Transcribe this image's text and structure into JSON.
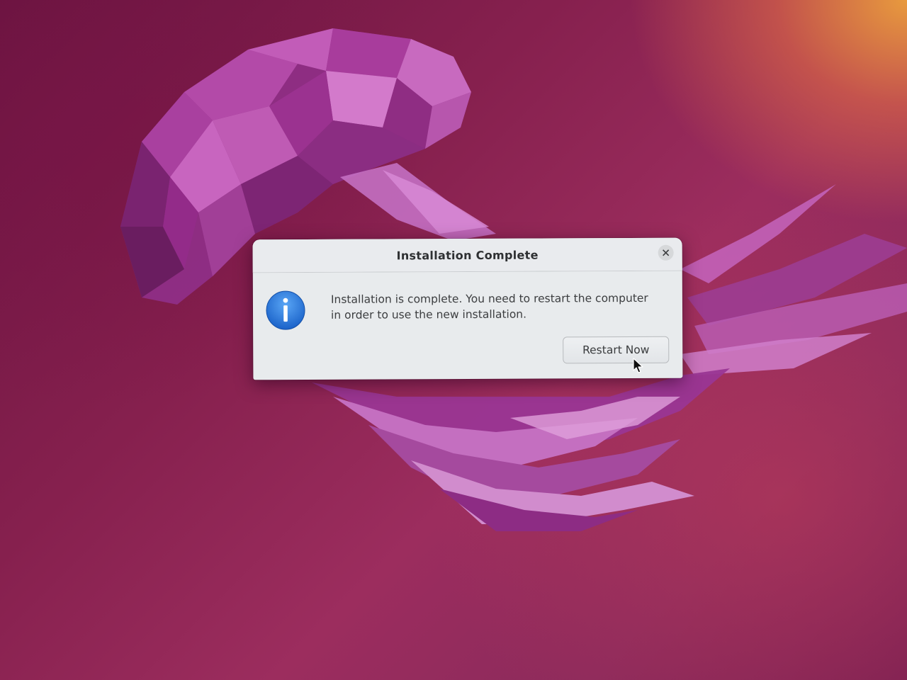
{
  "dialog": {
    "title": "Installation Complete",
    "message_line1": "Installation is complete. You need to restart the computer",
    "message_line2": "in order to use the new installation.",
    "restart_label": "Restart Now"
  },
  "icons": {
    "close": "close-icon",
    "info": "info-icon",
    "cursor": "mouse-pointer-icon"
  },
  "colors": {
    "info_blue": "#1f6fd8",
    "dialog_bg": "#e8ebed",
    "wallpaper_purple": "#8c2a5c",
    "wallpaper_orange": "#e99f3c"
  }
}
